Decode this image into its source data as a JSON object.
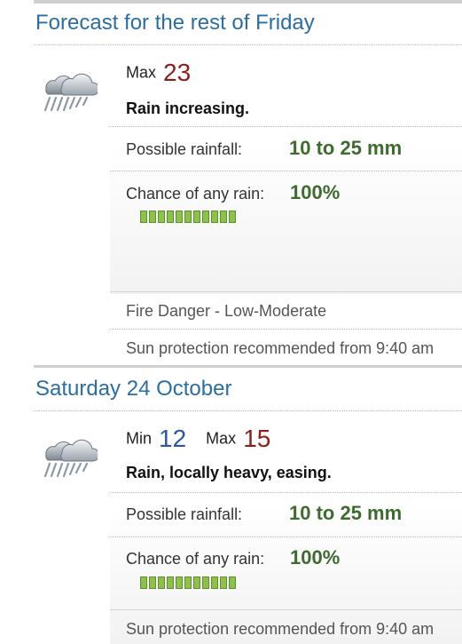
{
  "sections": [
    {
      "title": "Forecast for the rest of Friday",
      "icon": "rain-cloud-icon",
      "max_label": "Max",
      "max_value": "23",
      "summary": "Rain increasing.",
      "rainfall_label": "Possible rainfall:",
      "rainfall_value": "10 to 25 mm",
      "chance_label": "Chance of any rain:",
      "chance_value": "100%",
      "chance_fraction": 1.0,
      "fire_danger": "Fire Danger - Low-Moderate",
      "sun_protection": "Sun protection recommended from 9:40 am"
    },
    {
      "title": "Saturday 24 October",
      "icon": "rain-cloud-icon",
      "min_label": "Min",
      "min_value": "12",
      "max_label": "Max",
      "max_value": "15",
      "summary": "Rain, locally heavy, easing.",
      "rainfall_label": "Possible rainfall:",
      "rainfall_value": "10 to 25 mm",
      "chance_label": "Chance of any rain:",
      "chance_value": "100%",
      "chance_fraction": 1.0,
      "sun_protection": "Sun protection recommended from 9:40 am"
    }
  ],
  "colors": {
    "title": "#2a6ea3",
    "max_temp": "#8e1e19",
    "min_temp": "#2b58a6",
    "value_green": "#3e6b2e",
    "bar_fill": "#8cc24a"
  }
}
